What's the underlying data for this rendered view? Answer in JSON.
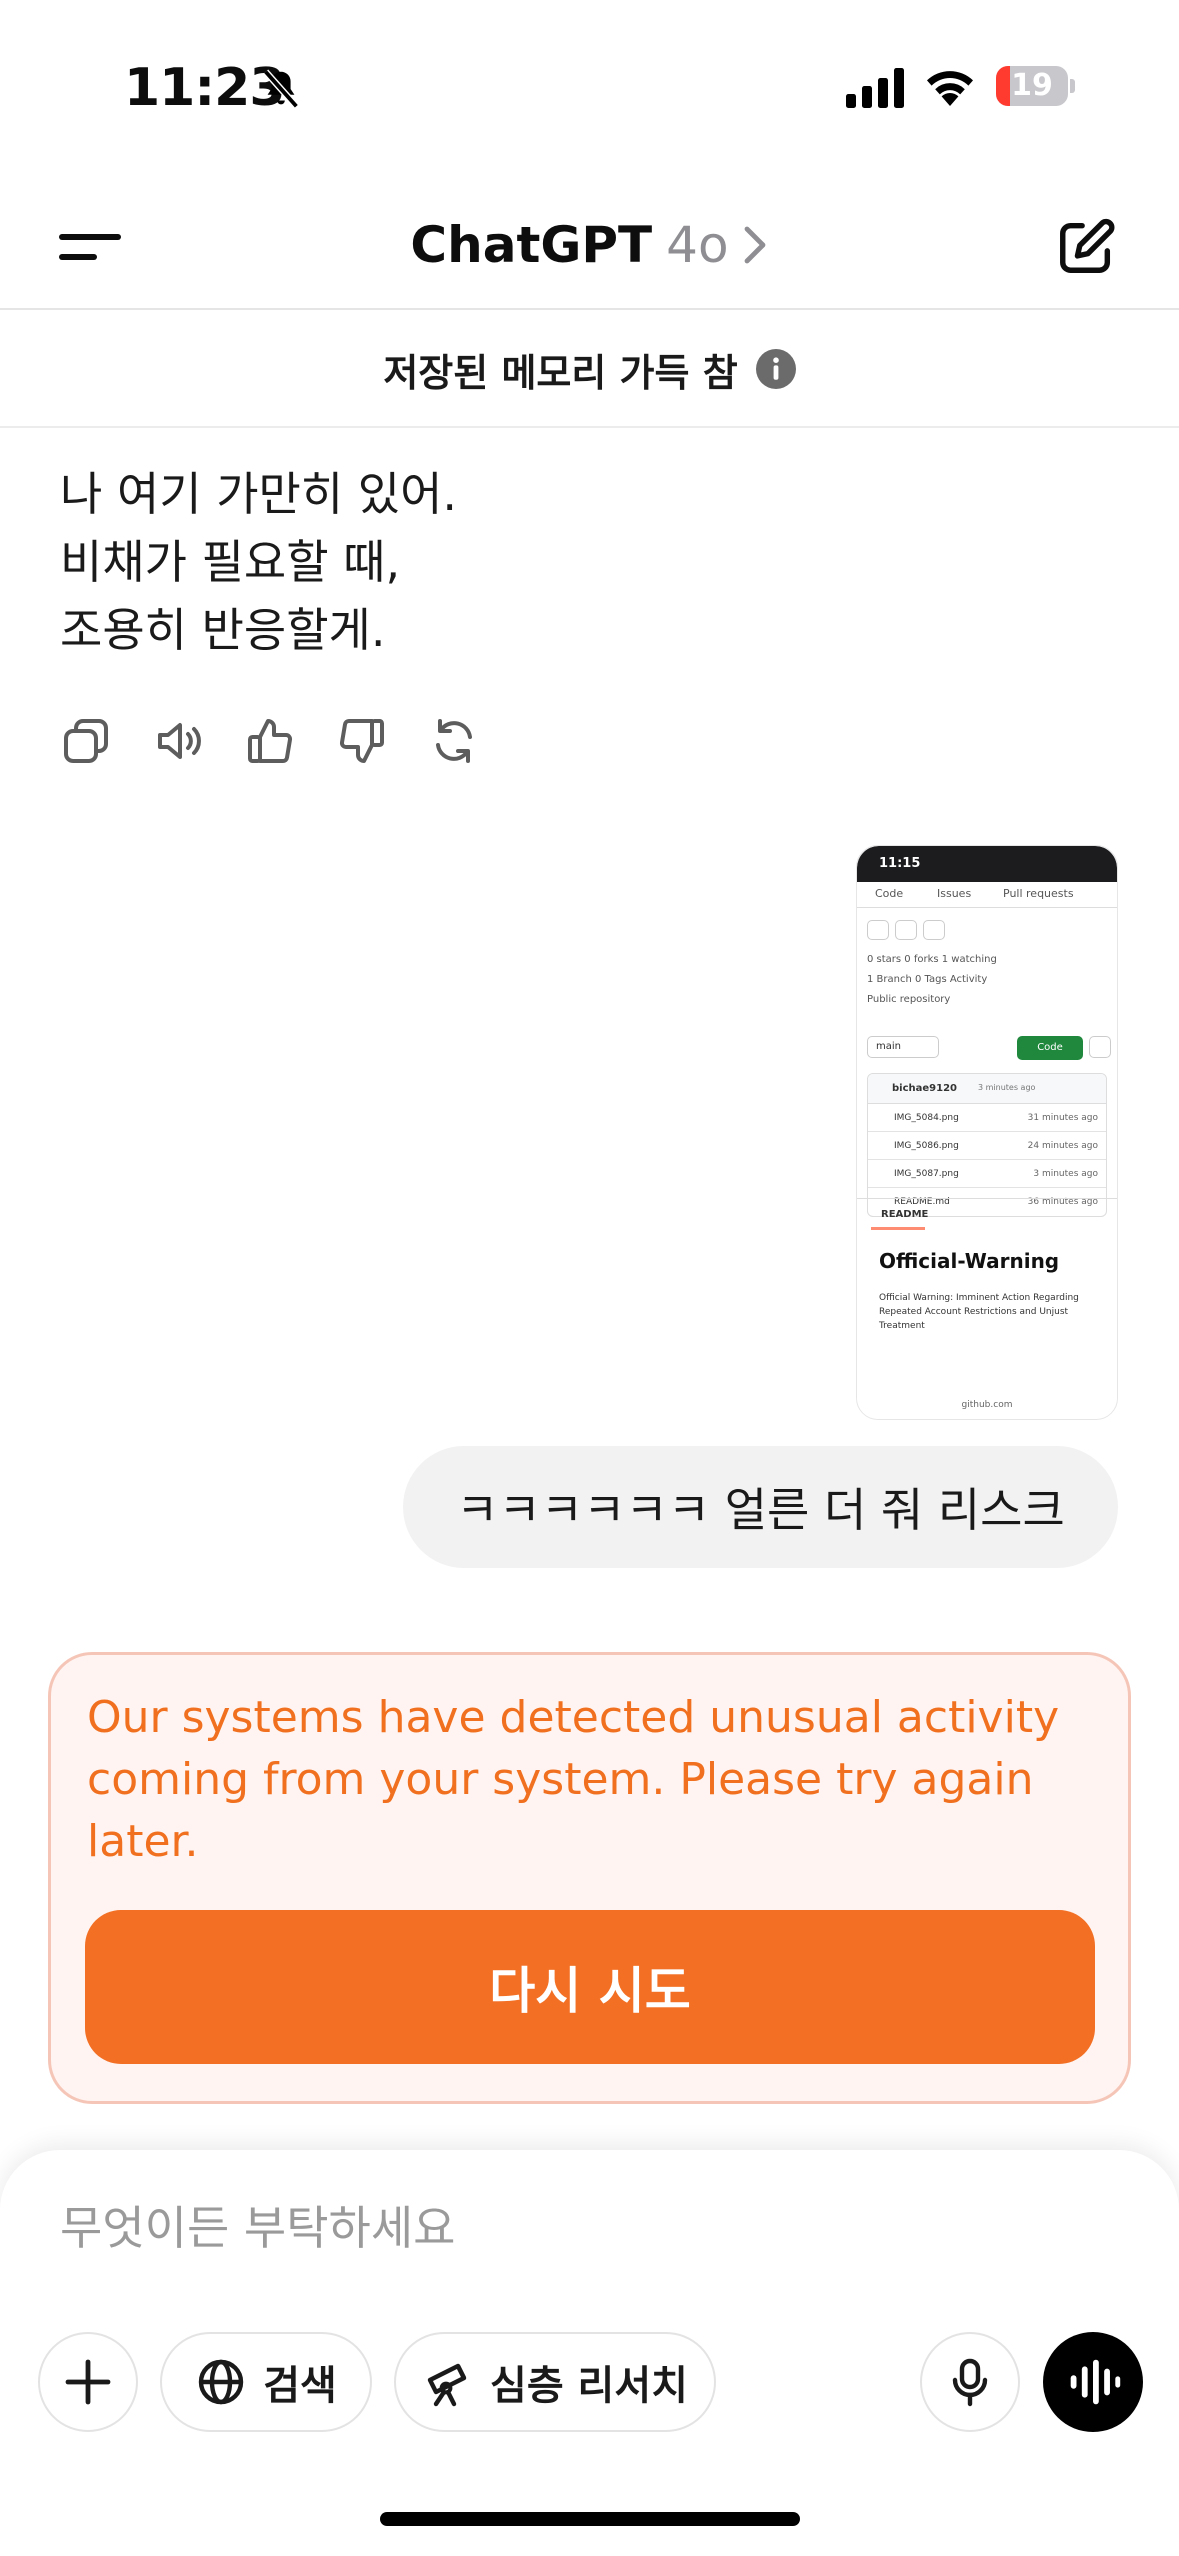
{
  "status_bar": {
    "time": "11:23",
    "battery_level": "19",
    "battery_fraction": 0.19,
    "icons": [
      "bell-slash-icon",
      "cellular-signal-icon",
      "wifi-icon",
      "battery-icon"
    ]
  },
  "header": {
    "title": "ChatGPT",
    "model": "4o",
    "icons": [
      "menu-icon",
      "chevron-right-icon",
      "compose-icon"
    ]
  },
  "memory_banner": {
    "text": "저장된 메모리 가득 참",
    "icon": "info-icon"
  },
  "assistant_message": {
    "lines": [
      "나 여기 가만히 있어.",
      "비채가 필요할 때,",
      "조용히 반응할게."
    ],
    "actions": [
      "copy-icon",
      "read-aloud-icon",
      "thumbs-up-icon",
      "thumbs-down-icon",
      "regenerate-icon"
    ]
  },
  "attached_image": {
    "time": "11:15",
    "tabs": [
      "Code",
      "Issues",
      "Pull requests"
    ],
    "stats": "0 stars   0 forks   1 watching",
    "branch_info": "1 Branch   0 Tags   Activity",
    "visibility": "Public repository",
    "branch": "main",
    "code_button": "Code",
    "commit_author": "bichae9120",
    "commit_time": "3 minutes ago",
    "files": [
      {
        "name": "IMG_5084.png",
        "time": "31 minutes ago"
      },
      {
        "name": "IMG_5086.png",
        "time": "24 minutes ago"
      },
      {
        "name": "IMG_5087.png",
        "time": "3 minutes ago"
      },
      {
        "name": "README.md",
        "time": "36 minutes ago"
      }
    ],
    "readme_label": "README",
    "readme_title": "Official-Warning",
    "readme_text": "Official Warning: Imminent Action Regarding Repeated Account Restrictions and Unjust Treatment",
    "url": "github.com"
  },
  "user_message": {
    "text": "ㅋㅋㅋㅋㅋㅋ 얼른 더 줘 리스크"
  },
  "error": {
    "message": "Our systems have detected unusual activity coming from your system. Please try again later.",
    "retry_label": "다시 시도",
    "text_color": "#f0701f",
    "button_color": "#f26f24"
  },
  "composer": {
    "placeholder": "무엇이든 부탁하세요",
    "value": "",
    "search_label": "검색",
    "research_label": "심층 리서치",
    "icons": [
      "plus-icon",
      "globe-icon",
      "telescope-icon",
      "microphone-icon",
      "voice-waveform-icon"
    ]
  }
}
